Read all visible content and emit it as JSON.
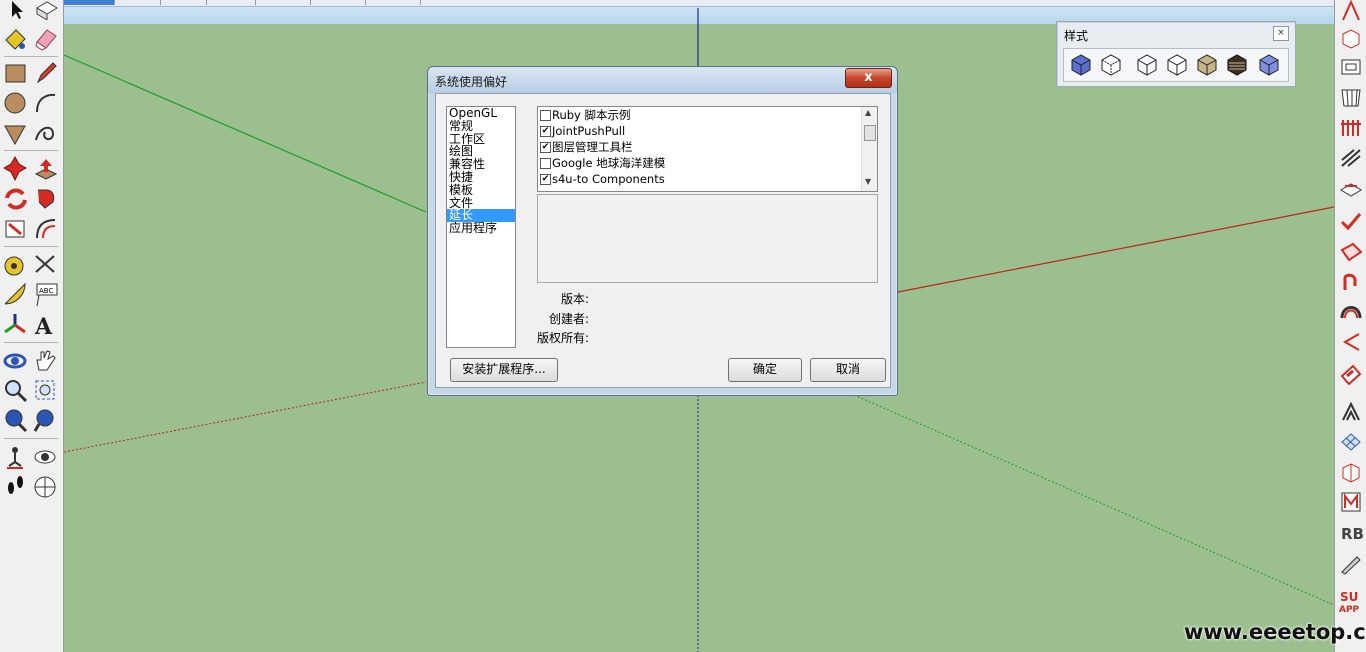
{
  "top_tabs": [
    "",
    "",
    "",
    "",
    "",
    "",
    "",
    ""
  ],
  "styles_panel": {
    "title": "样式",
    "close": "×"
  },
  "dialog": {
    "title": "系统使用偏好",
    "close": "x",
    "categories": [
      "OpenGL",
      "常规",
      "工作区",
      "绘图",
      "兼容性",
      "快捷",
      "模板",
      "文件",
      "延长",
      "应用程序"
    ],
    "selected_category": "延长",
    "extensions": [
      {
        "label": "Ruby 脚本示例",
        "checked": false
      },
      {
        "label": "JointPushPull",
        "checked": true
      },
      {
        "label": "图层管理工具栏",
        "checked": true
      },
      {
        "label": "Google 地球海洋建模",
        "checked": false
      },
      {
        "label": "s4u-to Components",
        "checked": true
      }
    ],
    "version_label": "版本:",
    "creator_label": "创建者:",
    "copyright_label": "版权所有:",
    "install_button": "安装扩展程序...",
    "ok_button": "确定",
    "cancel_button": "取消"
  },
  "watermark": "www.eeeetop.com",
  "colors": {
    "background": "#9bbf8f",
    "red_axis": "#c0221c",
    "green_axis": "#1f9c2a",
    "blue_axis": "#1b2c8c",
    "selection": "#3399ff"
  }
}
